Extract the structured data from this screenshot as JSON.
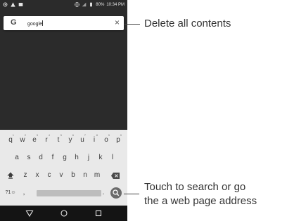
{
  "status_bar": {
    "battery": "80%",
    "time": "10:34 PM"
  },
  "search": {
    "logo": "G",
    "query": "google",
    "clear": "×"
  },
  "keyboard": {
    "row1": [
      {
        "l": "q",
        "n": "1"
      },
      {
        "l": "w",
        "n": "2"
      },
      {
        "l": "e",
        "n": "3"
      },
      {
        "l": "r",
        "n": "4"
      },
      {
        "l": "t",
        "n": "5"
      },
      {
        "l": "y",
        "n": "6"
      },
      {
        "l": "u",
        "n": "7"
      },
      {
        "l": "i",
        "n": "8"
      },
      {
        "l": "o",
        "n": "9"
      },
      {
        "l": "p",
        "n": "0"
      }
    ],
    "row2": [
      "a",
      "s",
      "d",
      "f",
      "g",
      "h",
      "j",
      "k",
      "l"
    ],
    "row3": [
      "z",
      "x",
      "c",
      "v",
      "b",
      "n",
      "m"
    ],
    "symbols": "?1☺",
    "comma": ",",
    "period": ".",
    "shift_icon": "shift-icon",
    "backspace_icon": "backspace-icon"
  },
  "annotations": {
    "clear": "Delete all contents",
    "search_line1": "Touch to search or go",
    "search_line2": "the a web page address"
  }
}
